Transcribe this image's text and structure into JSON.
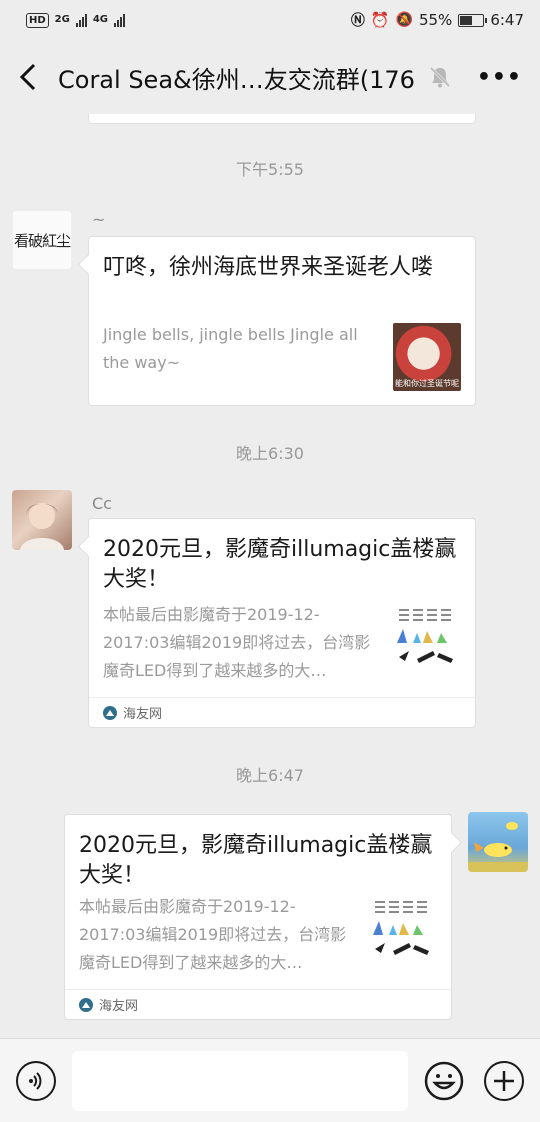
{
  "status_bar": {
    "hd": "HD",
    "net1": "2G",
    "net2": "4G",
    "battery": "55%",
    "battery_level": 0.55,
    "time": "6:47"
  },
  "header": {
    "title": "Coral Sea&徐州…友交流群(176)",
    "back_icon": "chevron-left-icon",
    "mute_icon": "bell-off-icon",
    "more_label": "•••"
  },
  "messages": [
    {
      "time": "下午5:55",
      "sender": "~",
      "avatar_text": "看破紅尘",
      "title": "叮咚，徐州海底世界来圣诞老人喽",
      "desc": "Jingle bells, jingle bells Jingle all the way~",
      "thumb_caption": "能和你过圣诞节呢"
    },
    {
      "time": "晚上6:30",
      "sender": "Cc",
      "title": "2020元旦，影魔奇illumagic盖楼赢大奖！",
      "desc": "本帖最后由影魔奇于2019-12-2017:03编辑2019即将过去，台湾影魔奇LED得到了越来越多的大…",
      "source": "海友网"
    },
    {
      "time": "晚上6:47",
      "title": "2020元旦，影魔奇illumagic盖楼赢大奖！",
      "desc": "本帖最后由影魔奇于2019-12-2017:03编辑2019即将过去，台湾影魔奇LED得到了越来越多的大…",
      "source": "海友网"
    }
  ],
  "input_bar": {
    "voice_icon": "voice-icon",
    "emoji_icon": "emoji-icon",
    "plus_icon": "plus-icon",
    "placeholder": ""
  }
}
